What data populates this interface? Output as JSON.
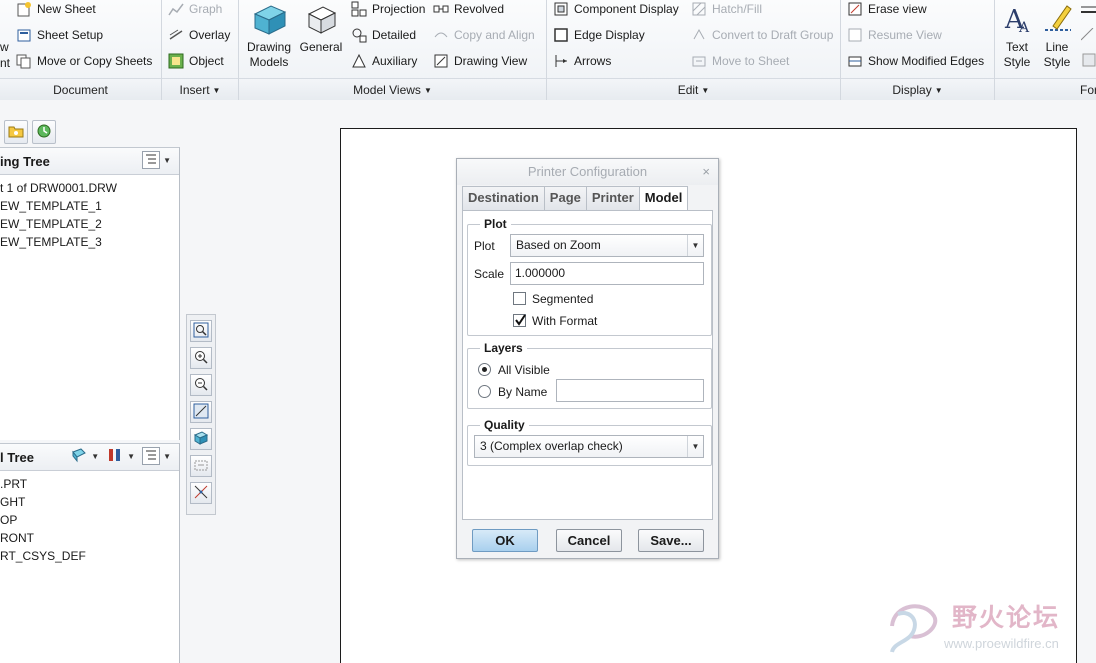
{
  "ribbon": {
    "document": {
      "label": "Document",
      "cut_label_1": "w",
      "cut_label_2": "nt",
      "items": [
        "New Sheet",
        "Sheet Setup",
        "Move or Copy Sheets"
      ]
    },
    "insert": {
      "label": "Insert",
      "items": [
        "Graph",
        "Overlay",
        "Object"
      ]
    },
    "model_views": {
      "label": "Model Views",
      "big1": [
        "Drawing",
        "Models"
      ],
      "big2": "General",
      "col1": [
        "Projection",
        "Detailed",
        "Auxiliary"
      ],
      "col2": [
        "Revolved",
        "Copy and Align",
        "Drawing View"
      ]
    },
    "edit": {
      "label": "Edit",
      "col1": [
        "Component Display",
        "Edge Display",
        "Arrows"
      ],
      "col2": [
        "Hatch/Fill",
        "Convert to Draft Group",
        "Move to Sheet"
      ]
    },
    "display": {
      "label": "Display",
      "items": [
        "Erase view",
        "Resume View",
        "Show Modified Edges"
      ]
    },
    "format": {
      "label": "For",
      "text_style": [
        "Text",
        "Style"
      ],
      "line_style": [
        "Line",
        "Style"
      ]
    }
  },
  "model_tree": {
    "title": "ing Tree",
    "items": [
      "t 1 of DRW0001.DRW",
      "EW_TEMPLATE_1",
      "EW_TEMPLATE_2",
      "EW_TEMPLATE_3"
    ]
  },
  "layer_tree": {
    "title": "l Tree",
    "items": [
      ".PRT",
      "GHT",
      "OP",
      "RONT",
      "RT_CSYS_DEF"
    ]
  },
  "dialog": {
    "title": "Printer Configuration",
    "close": "×",
    "tabs": [
      "Destination",
      "Page",
      "Printer",
      "Model"
    ],
    "active_tab": "Model",
    "plot_group": {
      "legend": "Plot",
      "plot_label": "Plot",
      "plot_value": "Based on Zoom",
      "scale_label": "Scale",
      "scale_value": "1.000000",
      "segmented_label": "Segmented",
      "segmented_checked": false,
      "with_format_label": "With Format",
      "with_format_checked": true
    },
    "layers_group": {
      "legend": "Layers",
      "all_visible_label": "All Visible",
      "by_name_label": "By Name",
      "selected": "All Visible",
      "by_name_value": ""
    },
    "quality_group": {
      "legend": "Quality",
      "value": "3 (Complex overlap check)"
    },
    "buttons": {
      "ok": "OK",
      "cancel": "Cancel",
      "save": "Save..."
    }
  },
  "watermark": {
    "text_cn": "野火论坛",
    "url": "www.proewildfire.cn"
  },
  "colors": {
    "accent_ok_button": "#a9d0ee",
    "ribbon_bg": "#eef1f5",
    "canvas_bg": "#f5f6f8",
    "watermark_pink": "#e2b6c8"
  }
}
